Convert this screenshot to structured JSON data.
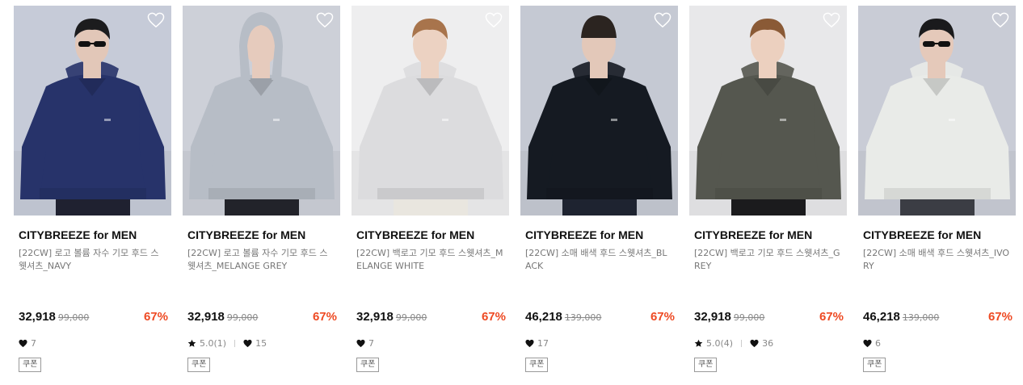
{
  "products": [
    {
      "brand": "CITYBREEZE for MEN",
      "name": "[22CW] 로고 볼륨 자수 기모 후드 스웻셔츠_NAVY",
      "price": "32,918",
      "original_price": "99,000",
      "discount": "67%",
      "rating": "",
      "likes": "7",
      "coupon": "쿠폰",
      "image": {
        "bg": "#c6cbd8",
        "garment": "#27336a",
        "skin": "#e2c7b8",
        "hair": "#1c1c1e",
        "pants": "#1f2130",
        "sunglasses": true,
        "hood_up": false,
        "beanie": false
      },
      "icons": {
        "wishlist": "heart-outline-icon",
        "likes": "heart-filled-icon"
      }
    },
    {
      "brand": "CITYBREEZE for MEN",
      "name": "[22CW] 로고 볼륨 자수 기모 후드 스웻셔츠_MELANGE GREY",
      "price": "32,918",
      "original_price": "99,000",
      "discount": "67%",
      "rating": "5.0(1)",
      "likes": "15",
      "coupon": "쿠폰",
      "image": {
        "bg": "#cdd0d8",
        "garment": "#b7bdc6",
        "skin": "#e6cbbd",
        "hair": "#4a3a30",
        "pants": "#22232a",
        "sunglasses": false,
        "hood_up": true,
        "beanie": false
      },
      "icons": {
        "wishlist": "heart-outline-icon",
        "rating": "star-icon",
        "likes": "heart-filled-icon"
      }
    },
    {
      "brand": "CITYBREEZE for MEN",
      "name": "[22CW] 백로고 기모 후드 스웻셔츠_MELANGE WHITE",
      "price": "32,918",
      "original_price": "99,000",
      "discount": "67%",
      "rating": "",
      "likes": "7",
      "coupon": "쿠폰",
      "image": {
        "bg": "#eeeeef",
        "garment": "#dcdcde",
        "skin": "#ecd2c2",
        "hair": "#a8744c",
        "pants": "#e9e6df",
        "sunglasses": false,
        "hood_up": false,
        "beanie": false
      },
      "icons": {
        "wishlist": "heart-outline-icon",
        "likes": "heart-filled-icon"
      }
    },
    {
      "brand": "CITYBREEZE for MEN",
      "name": "[22CW] 소매 배색 후드 스웻셔츠_BLACK",
      "price": "46,218",
      "original_price": "139,000",
      "discount": "67%",
      "rating": "",
      "likes": "17",
      "coupon": "쿠폰",
      "image": {
        "bg": "#c5c9d3",
        "garment": "#151a22",
        "skin": "#e3c8b9",
        "hair": "#2b2420",
        "pants": "#1e2330",
        "sunglasses": false,
        "hood_up": false,
        "beanie": true
      },
      "icons": {
        "wishlist": "heart-outline-icon",
        "likes": "heart-filled-icon"
      }
    },
    {
      "brand": "CITYBREEZE for MEN",
      "name": "[22CW] 백로고 기모 후드 스웻셔츠_GREY",
      "price": "32,918",
      "original_price": "99,000",
      "discount": "67%",
      "rating": "5.0(4)",
      "likes": "36",
      "coupon": "쿠폰",
      "image": {
        "bg": "#e8e8ea",
        "garment": "#55574f",
        "skin": "#ecd0bf",
        "hair": "#8a5a36",
        "pants": "#1b1b1d",
        "sunglasses": false,
        "hood_up": false,
        "beanie": false
      },
      "icons": {
        "wishlist": "heart-outline-icon",
        "rating": "star-icon",
        "likes": "heart-filled-icon"
      }
    },
    {
      "brand": "CITYBREEZE for MEN",
      "name": "[22CW] 소매 배색 후드 스웻셔츠_IVORY",
      "price": "46,218",
      "original_price": "139,000",
      "discount": "67%",
      "rating": "",
      "likes": "6",
      "coupon": "쿠폰",
      "image": {
        "bg": "#c9ccd6",
        "garment": "#e9ebe8",
        "skin": "#e5c9ba",
        "hair": "#1a1a1c",
        "pants": "#3b3d44",
        "sunglasses": true,
        "hood_up": false,
        "beanie": false
      },
      "icons": {
        "wishlist": "heart-outline-icon",
        "likes": "heart-filled-icon"
      }
    }
  ],
  "colors": {
    "discount": "#ee4a23",
    "brand": "#111111",
    "meta": "#888888"
  }
}
